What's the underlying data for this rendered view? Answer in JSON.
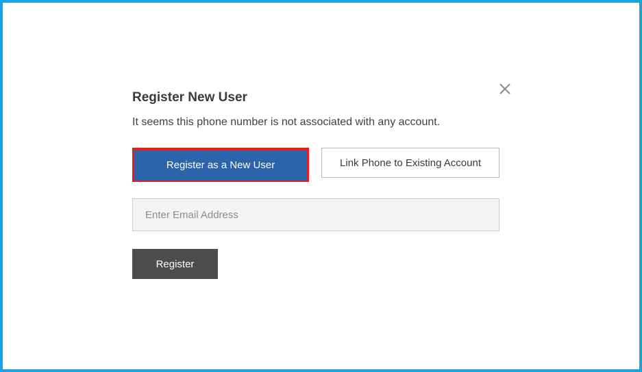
{
  "modal": {
    "title": "Register New User",
    "subtitle": "It seems this phone number is not associated with any account.",
    "tabs": {
      "register_new": "Register as a New User",
      "link_existing": "Link Phone to Existing Account"
    },
    "email_placeholder": "Enter Email Address",
    "email_value": "",
    "register_button": "Register"
  }
}
